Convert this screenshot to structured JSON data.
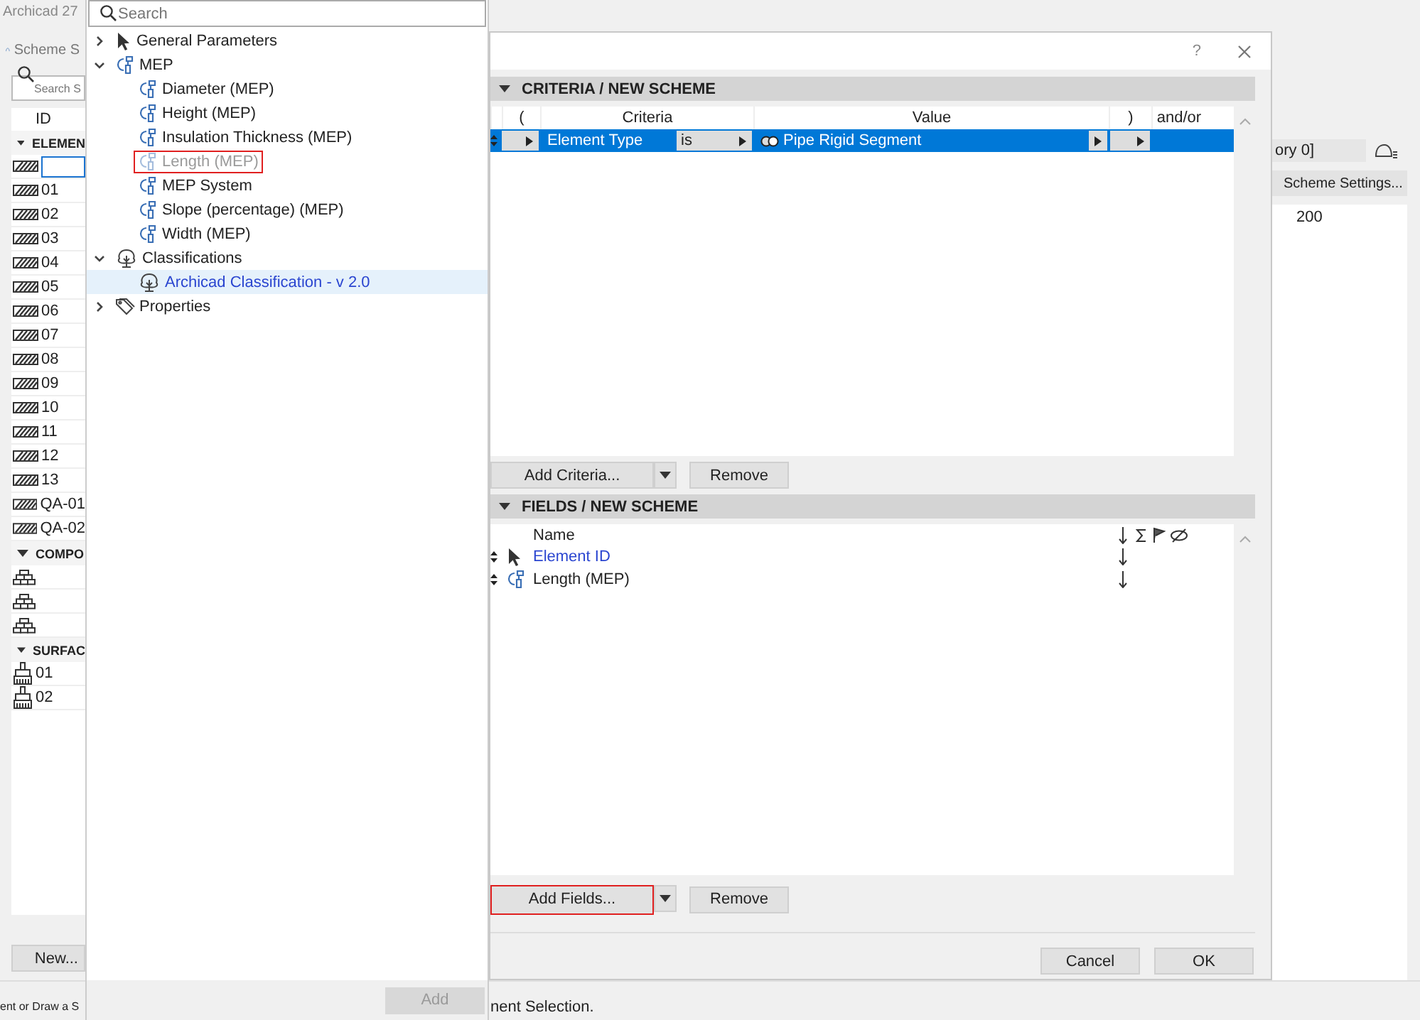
{
  "app": {
    "title": "Archicad 27",
    "tab": "Scheme S",
    "search": {
      "placeholder": "Search S"
    },
    "id_column": "ID",
    "groups": [
      {
        "label": "ELEMEN",
        "kind": "hatch",
        "expanded": true,
        "items": [
          {
            "selected": true
          },
          {
            "id": "01",
            "selected": false
          },
          {
            "id": "02",
            "selected": false
          },
          {
            "id": "03",
            "selected": false
          },
          {
            "id": "04",
            "selected": false
          },
          {
            "id": "05",
            "selected": false
          },
          {
            "id": "06",
            "selected": false
          },
          {
            "id": "07",
            "selected": false
          },
          {
            "id": "08",
            "selected": false
          },
          {
            "id": "09",
            "selected": false
          },
          {
            "id": "10",
            "selected": false
          },
          {
            "id": "11",
            "selected": false
          },
          {
            "id": "12",
            "selected": false
          },
          {
            "id": "13",
            "selected": false
          },
          {
            "id": "QA-01",
            "selected": false
          },
          {
            "id": "QA-02",
            "selected": false
          }
        ]
      },
      {
        "label": "COMPO",
        "kind": "brick",
        "expanded": true,
        "items": [
          {
            "selected": false
          },
          {
            "selected": false
          },
          {
            "selected": false
          }
        ]
      },
      {
        "label": "SURFAC",
        "kind": "brush",
        "expanded": true,
        "items": [
          {
            "id": "01",
            "selected": false
          },
          {
            "id": "02",
            "selected": false
          }
        ]
      }
    ],
    "new_button": "New...",
    "status_left": "ent or Draw a S",
    "status_right": "nent Selection.",
    "right_panel": {
      "field": "ory 0]",
      "button": "Scheme Settings...",
      "ruler": "200"
    }
  },
  "picker": {
    "search": {
      "placeholder": "Search"
    },
    "tree": [
      {
        "label": "General Parameters",
        "kind": "pointer",
        "expanded": false,
        "selected": false
      },
      {
        "label": "MEP",
        "kind": "mep",
        "expanded": true,
        "selected": false,
        "children": [
          {
            "label": "Diameter (MEP)",
            "kind": "mep",
            "selected": false,
            "disabled": false,
            "annotated": false
          },
          {
            "label": "Height (MEP)",
            "kind": "mep",
            "selected": false,
            "disabled": false,
            "annotated": false
          },
          {
            "label": "Insulation Thickness (MEP)",
            "kind": "mep",
            "selected": false,
            "disabled": false,
            "annotated": false
          },
          {
            "label": "Length (MEP)",
            "kind": "mep",
            "selected": false,
            "disabled": true,
            "annotated": true
          },
          {
            "label": "MEP System",
            "kind": "mep",
            "selected": false,
            "disabled": false,
            "annotated": false
          },
          {
            "label": "Slope (percentage) (MEP)",
            "kind": "mep",
            "selected": false,
            "disabled": false,
            "annotated": false
          },
          {
            "label": "Width (MEP)",
            "kind": "mep",
            "selected": false,
            "disabled": false,
            "annotated": false
          }
        ]
      },
      {
        "label": "Classifications",
        "kind": "classification",
        "expanded": true,
        "selected": false,
        "children": [
          {
            "label": "Archicad Classification - v 2.0",
            "kind": "classification",
            "selected": true,
            "disabled": false,
            "annotated": false
          }
        ]
      },
      {
        "label": "Properties",
        "kind": "tag",
        "expanded": false,
        "selected": false
      }
    ],
    "add_button": {
      "label": "Add",
      "disabled": true
    }
  },
  "dialog": {
    "help": "?",
    "criteria": {
      "title": "CRITERIA /  NEW SCHEME",
      "columns": [
        "(",
        "Criteria",
        "Value",
        ")",
        "and/or"
      ],
      "rows": [
        {
          "criteria": "Element Type",
          "operator": "is",
          "value": "Pipe Rigid Segment",
          "selected": true
        }
      ],
      "add_button": "Add Criteria...",
      "remove_button": "Remove"
    },
    "fields": {
      "title": "FIELDS /  NEW SCHEME",
      "name_column": "Name",
      "rows": [
        {
          "name": "Element ID",
          "kind": "pointer",
          "highlighted": true
        },
        {
          "name": "Length (MEP)",
          "kind": "mep",
          "highlighted": false
        }
      ],
      "add_button": {
        "label": "Add Fields...",
        "annotated": true
      },
      "remove_button": "Remove"
    },
    "cancel_button": "Cancel",
    "ok_button": "OK"
  }
}
